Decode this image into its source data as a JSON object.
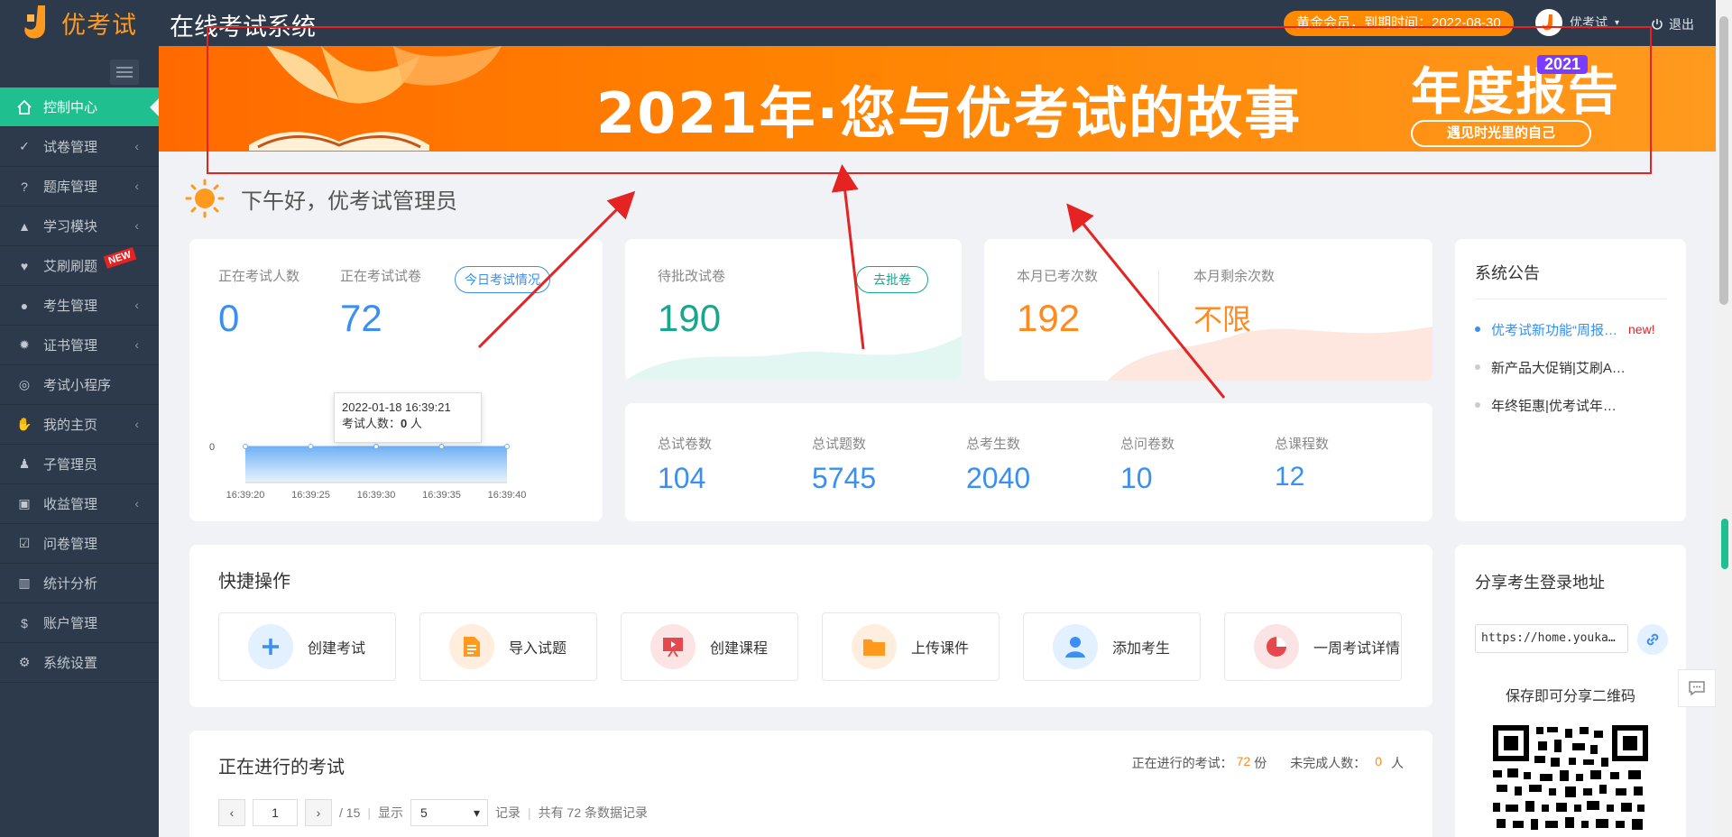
{
  "header": {
    "logo_text": "优考试",
    "system_title": "在线考试系统",
    "vip_text": "黄金会员，到期时间：2022-08-30",
    "user_name": "优考试",
    "logout_label": "退出"
  },
  "sidebar": {
    "items": [
      {
        "label": "控制中心",
        "icon": "home-icon",
        "active": true
      },
      {
        "label": "试卷管理",
        "icon": "check-circle-icon"
      },
      {
        "label": "题库管理",
        "icon": "question-circle-icon"
      },
      {
        "label": "学习模块",
        "icon": "graduation-cap-icon"
      },
      {
        "label": "艾刷刷题",
        "icon": "heart-icon",
        "badge": "NEW"
      },
      {
        "label": "考生管理",
        "icon": "user-icon"
      },
      {
        "label": "证书管理",
        "icon": "certificate-icon"
      },
      {
        "label": "考试小程序",
        "icon": "wechat-icon"
      },
      {
        "label": "我的主页",
        "icon": "hand-icon"
      },
      {
        "label": "子管理员",
        "icon": "admin-icon"
      },
      {
        "label": "收益管理",
        "icon": "money-icon"
      },
      {
        "label": "问卷管理",
        "icon": "checkbox-icon"
      },
      {
        "label": "统计分析",
        "icon": "bar-chart-icon"
      },
      {
        "label": "账户管理",
        "icon": "dollar-icon"
      },
      {
        "label": "系统设置",
        "icon": "gear-icon"
      }
    ]
  },
  "banner": {
    "title": "2021年·您与优考试的故事",
    "report_big": "年度报告",
    "report_year": "2021",
    "report_sub": "遇见时光里的自己"
  },
  "greeting": "下午好，优考试管理员",
  "exam_now": {
    "label_people": "正在考试人数",
    "value_people": "0",
    "label_papers": "正在考试试卷",
    "value_papers": "72",
    "link": "今日考试情况",
    "tooltip_time": "2022-01-18 16:39:21",
    "tooltip_label": "考试人数：",
    "tooltip_value": "0",
    "tooltip_unit": "人",
    "y_tick": "0"
  },
  "chart_data": {
    "type": "area",
    "x": [
      "16:39:20",
      "16:39:25",
      "16:39:30",
      "16:39:35",
      "16:39:40"
    ],
    "series": [
      {
        "values": [
          0,
          0,
          0,
          0,
          0
        ]
      }
    ],
    "xlabel": "",
    "ylabel": ""
  },
  "pending": {
    "label": "待批改试卷",
    "value": "190",
    "link": "去批卷"
  },
  "monthly": {
    "label_used": "本月已考次数",
    "value_used": "192",
    "label_left": "本月剩余次数",
    "value_left": "不限"
  },
  "totals": [
    {
      "label": "总试卷数",
      "value": "104"
    },
    {
      "label": "总试题数",
      "value": "5745"
    },
    {
      "label": "总考生数",
      "value": "2040"
    },
    {
      "label": "总问卷数",
      "value": "10"
    },
    {
      "label": "总课程数",
      "value": "12"
    }
  ],
  "notice": {
    "title": "系统公告",
    "items": [
      {
        "text": "优考试新功能“周报…",
        "tag": "new!"
      },
      {
        "text": "新产品大促销|艾刷A…"
      },
      {
        "text": "年终钜惠|优考试年…"
      }
    ]
  },
  "quick": {
    "title": "快捷操作",
    "buttons": [
      {
        "label": "创建考试",
        "icon": "plus-icon",
        "color": "#3b8ff0",
        "bg": "#e3f0ff"
      },
      {
        "label": "导入试题",
        "icon": "document-icon",
        "color": "#ff9a1f",
        "bg": "#ffeedd"
      },
      {
        "label": "创建课程",
        "icon": "presentation-icon",
        "color": "#e5484d",
        "bg": "#fde4e4"
      },
      {
        "label": "上传课件",
        "icon": "folder-icon",
        "color": "#ff9a1f",
        "bg": "#ffeedd"
      },
      {
        "label": "添加考生",
        "icon": "user-icon",
        "color": "#3b8ff0",
        "bg": "#e3f0ff"
      },
      {
        "label": "一周考试详情",
        "icon": "pie-chart-icon",
        "color": "#e5484d",
        "bg": "#fde4e4"
      }
    ]
  },
  "share": {
    "title": "分享考生登录地址",
    "url": "https://home.youka…",
    "qr_caption": "保存即可分享二维码"
  },
  "ongoing": {
    "title": "正在进行的考试",
    "count_label": "正在进行的考试：",
    "count_value": "72",
    "count_unit": "份",
    "unfinished_label": "未完成人数：",
    "unfinished_value": "0",
    "unfinished_unit": "人",
    "page_value": "1",
    "page_total": "/ 15",
    "show_label": "显示",
    "page_size": "5",
    "records_label": "记录",
    "total_records": "共有 72 条数据记录"
  },
  "colors": {
    "accent": "#1fbf8f",
    "blue": "#3b8ff0",
    "orange": "#ff8a1f",
    "teal": "#1aa58f",
    "annotation": "#e52323"
  }
}
